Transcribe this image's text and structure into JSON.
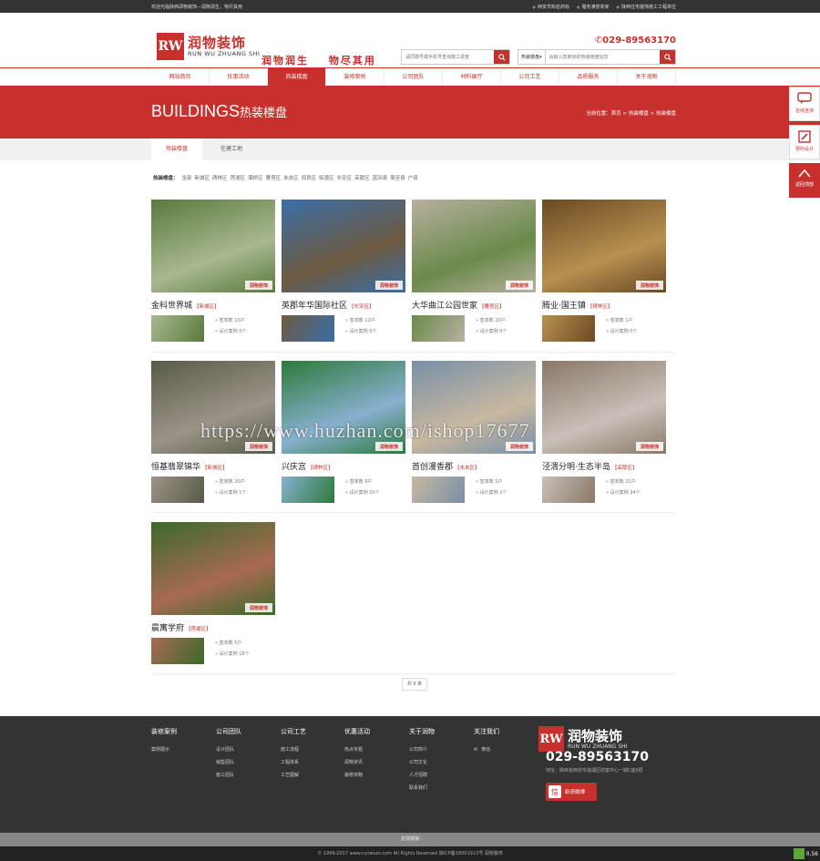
{
  "topbar": {
    "welcome": "欢迎光临陕西润物装饰—润物润生，物尽其用",
    "links": [
      "西安市知名商标",
      "服务满意商家",
      "陕西住宅装饰施工工程单位"
    ]
  },
  "header": {
    "logo_cn": "润物装饰",
    "logo_en": "RUN WU ZHUANG SHI",
    "slogan": "润物润生 物尽其用",
    "phone": "029-89563170",
    "search1_placeholder": "请同楼号或手机号查询施工进度",
    "search2_select": "热装楼盘",
    "search2_placeholder": "请输入您要找的热装楼盘信息"
  },
  "nav": [
    "网站首页",
    "优惠活动",
    "热装楼盘",
    "装修案例",
    "公司团队",
    "材料展厅",
    "公司工艺",
    "品质服务",
    "关于润物"
  ],
  "banner": {
    "title_en": "BUILDINGS",
    "title_cn": "热装楼盘",
    "crumbs": "当前位置：首页 > 热装楼盘 > 热装楼盘"
  },
  "subtabs": [
    "热装楼盘",
    "在建工地"
  ],
  "filter": {
    "label": "热装楼盘：",
    "items": [
      "全部",
      "新城区",
      "碑林区",
      "莲湖区",
      "灞桥区",
      "雁塔区",
      "未央区",
      "阎良区",
      "临潼区",
      "长安区",
      "高陵区",
      "蓝田县",
      "周至县",
      "户县"
    ]
  },
  "buildings": [
    {
      "name": "金科世界城",
      "district": "【新城区】",
      "s1": "签单数 10户",
      "s2": "设计案例 0个",
      "c1": "#5a7a3c",
      "c2": "#a8b890"
    },
    {
      "name": "英郡年华国际社区",
      "district": "【长安区】",
      "s1": "签单数 12户",
      "s2": "设计案例 0个",
      "c1": "#3b6ea8",
      "c2": "#6d5a40"
    },
    {
      "name": "大华曲江公园世家",
      "district": "【雁塔区】",
      "s1": "签单数 20户",
      "s2": "设计案例 0个",
      "c1": "#b8b0a0",
      "c2": "#6a8a4a"
    },
    {
      "name": "腾业·国王镇",
      "district": "【碑林区】",
      "s1": "签单数 1户",
      "s2": "设计案例 0个",
      "c1": "#6a4a22",
      "c2": "#b89050"
    },
    {
      "name": "恒基翡翠锦华",
      "district": "【新城区】",
      "s1": "签单数 20户",
      "s2": "设计案例 1个",
      "c1": "#5a5a48",
      "c2": "#9a9488"
    },
    {
      "name": "兴庆宫",
      "district": "【碑林区】",
      "s1": "签单数 9户",
      "s2": "设计案例 20个",
      "c1": "#2c7a3a",
      "c2": "#88b0d0"
    },
    {
      "name": "首创漫香郡",
      "district": "【未央区】",
      "s1": "签单数 5户",
      "s2": "设计案例 2个",
      "c1": "#7890a8",
      "c2": "#c8b8a0"
    },
    {
      "name": "泾渭分明·生态半岛",
      "district": "【高陵区】",
      "s1": "签单数 21户",
      "s2": "设计案例 34个",
      "c1": "#8a7868",
      "c2": "#c8c0b8"
    },
    {
      "name": "晨寓学府",
      "district": "【莲湖区】",
      "s1": "签单数 5户",
      "s2": "设计案例 18个",
      "c1": "#3a6a2a",
      "c2": "#a86a52"
    }
  ],
  "thumb_mark": "润物装饰",
  "pager": "共 9 条",
  "footer": {
    "cols": [
      {
        "title": "装修案例",
        "items": [
          "案例展示"
        ]
      },
      {
        "title": "公司团队",
        "items": [
          "设计团队",
          "销售团队",
          "施工团队"
        ]
      },
      {
        "title": "公司工艺",
        "items": [
          "施工流程",
          "工程体系",
          "工艺图解"
        ]
      },
      {
        "title": "优惠活动",
        "items": [
          "热点专题",
          "润物资讯",
          "装修攻略"
        ]
      },
      {
        "title": "关于润物",
        "items": [
          "公司简介",
          "公司文化",
          "人才招聘",
          "联系我们"
        ]
      },
      {
        "title": "关注我们",
        "items": [
          "微信"
        ]
      }
    ],
    "logo_cn": "润物装饰",
    "logo_en": "RUN WU ZHUANG SHI",
    "phone": "029-89563170",
    "address": "地址：陕西省西安市莲湖区财富中心一期C座9层",
    "weibo": "新浪微博",
    "links_label": "友情链接：",
    "copyright": "© 1999-2017 www.runwuzs.com All Rights Reserved 陕ICP备18001913号 润物装饰"
  },
  "side": [
    "在线咨询",
    "预约设计",
    "返回顶部"
  ],
  "speed": "0.56",
  "watermark": "https://www.huzhan.com/ishop17677",
  "colors": {
    "brand": "#c8302d",
    "dark": "#333333"
  }
}
